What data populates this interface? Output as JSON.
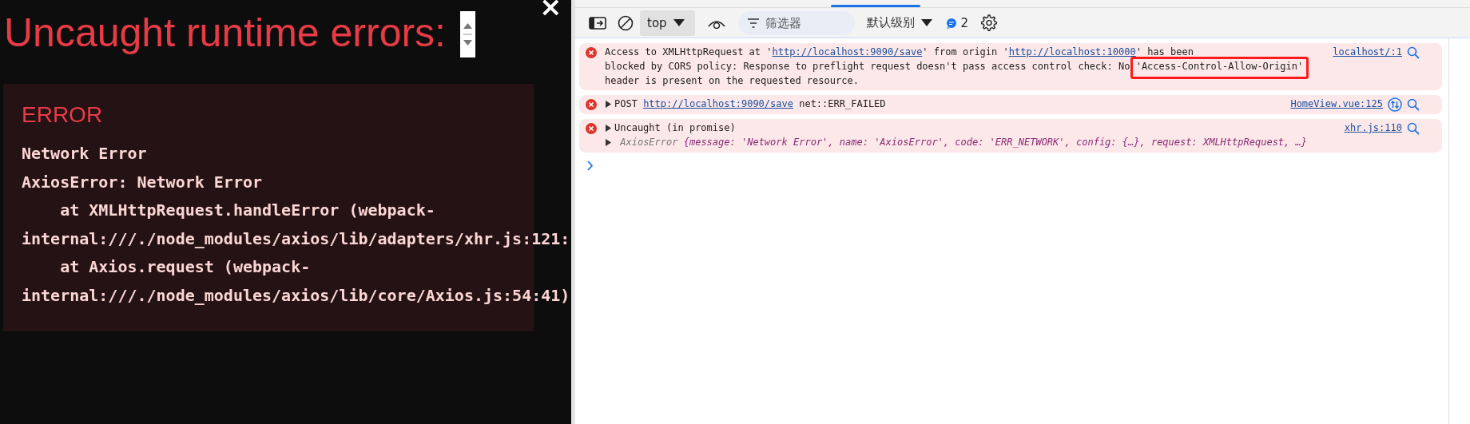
{
  "error_overlay": {
    "title": "Uncaught runtime errors:",
    "close": "×",
    "errors": [
      {
        "label": "ERROR",
        "stack": "Network Error\nAxiosError: Network Error\n    at XMLHttpRequest.handleError (webpack-\ninternal:///./node_modules/axios/lib/adapters/xhr.js:121:\n    at Axios.request (webpack-\ninternal:///./node_modules/axios/lib/core/Axios.js:54:41)"
      }
    ]
  },
  "devtools": {
    "toolbar": {
      "context": "top",
      "filter_placeholder": "筛选器",
      "levels": "默认级别",
      "issues_count": "2"
    },
    "messages": [
      {
        "kind": "error",
        "parts": [
          {
            "text": "Access to XMLHttpRequest at '"
          },
          {
            "link": "http://localhost:9090/save"
          },
          {
            "text": "' from origin '"
          },
          {
            "link": "http://localhost:10000"
          },
          {
            "text": "' has been\nblocked by CORS policy: Response to preflight request doesn't pass access control check: No "
          },
          {
            "text": "'Access-Control-Allow-Origin'",
            "highlight": true
          },
          {
            "text": "\nheader is present on the requested resource."
          }
        ],
        "source": "localhost/:1",
        "network": false
      },
      {
        "kind": "error",
        "expanded": false,
        "parts": [
          {
            "text": "POST "
          },
          {
            "link": "http://localhost:9090/save"
          },
          {
            "text": " net::ERR_FAILED"
          }
        ],
        "source": "HomeView.vue:125",
        "network": true
      },
      {
        "kind": "error",
        "expanded": false,
        "parts": [
          {
            "text": "Uncaught (in promise)"
          }
        ],
        "source": "xhr.js:110",
        "network": false,
        "detail": {
          "expanded": false,
          "type": "AxiosError",
          "body": "{message: 'Network Error', name: 'AxiosError', code: 'ERR_NETWORK', config: {…}, request: XMLHttpRequest, …}"
        }
      }
    ]
  }
}
